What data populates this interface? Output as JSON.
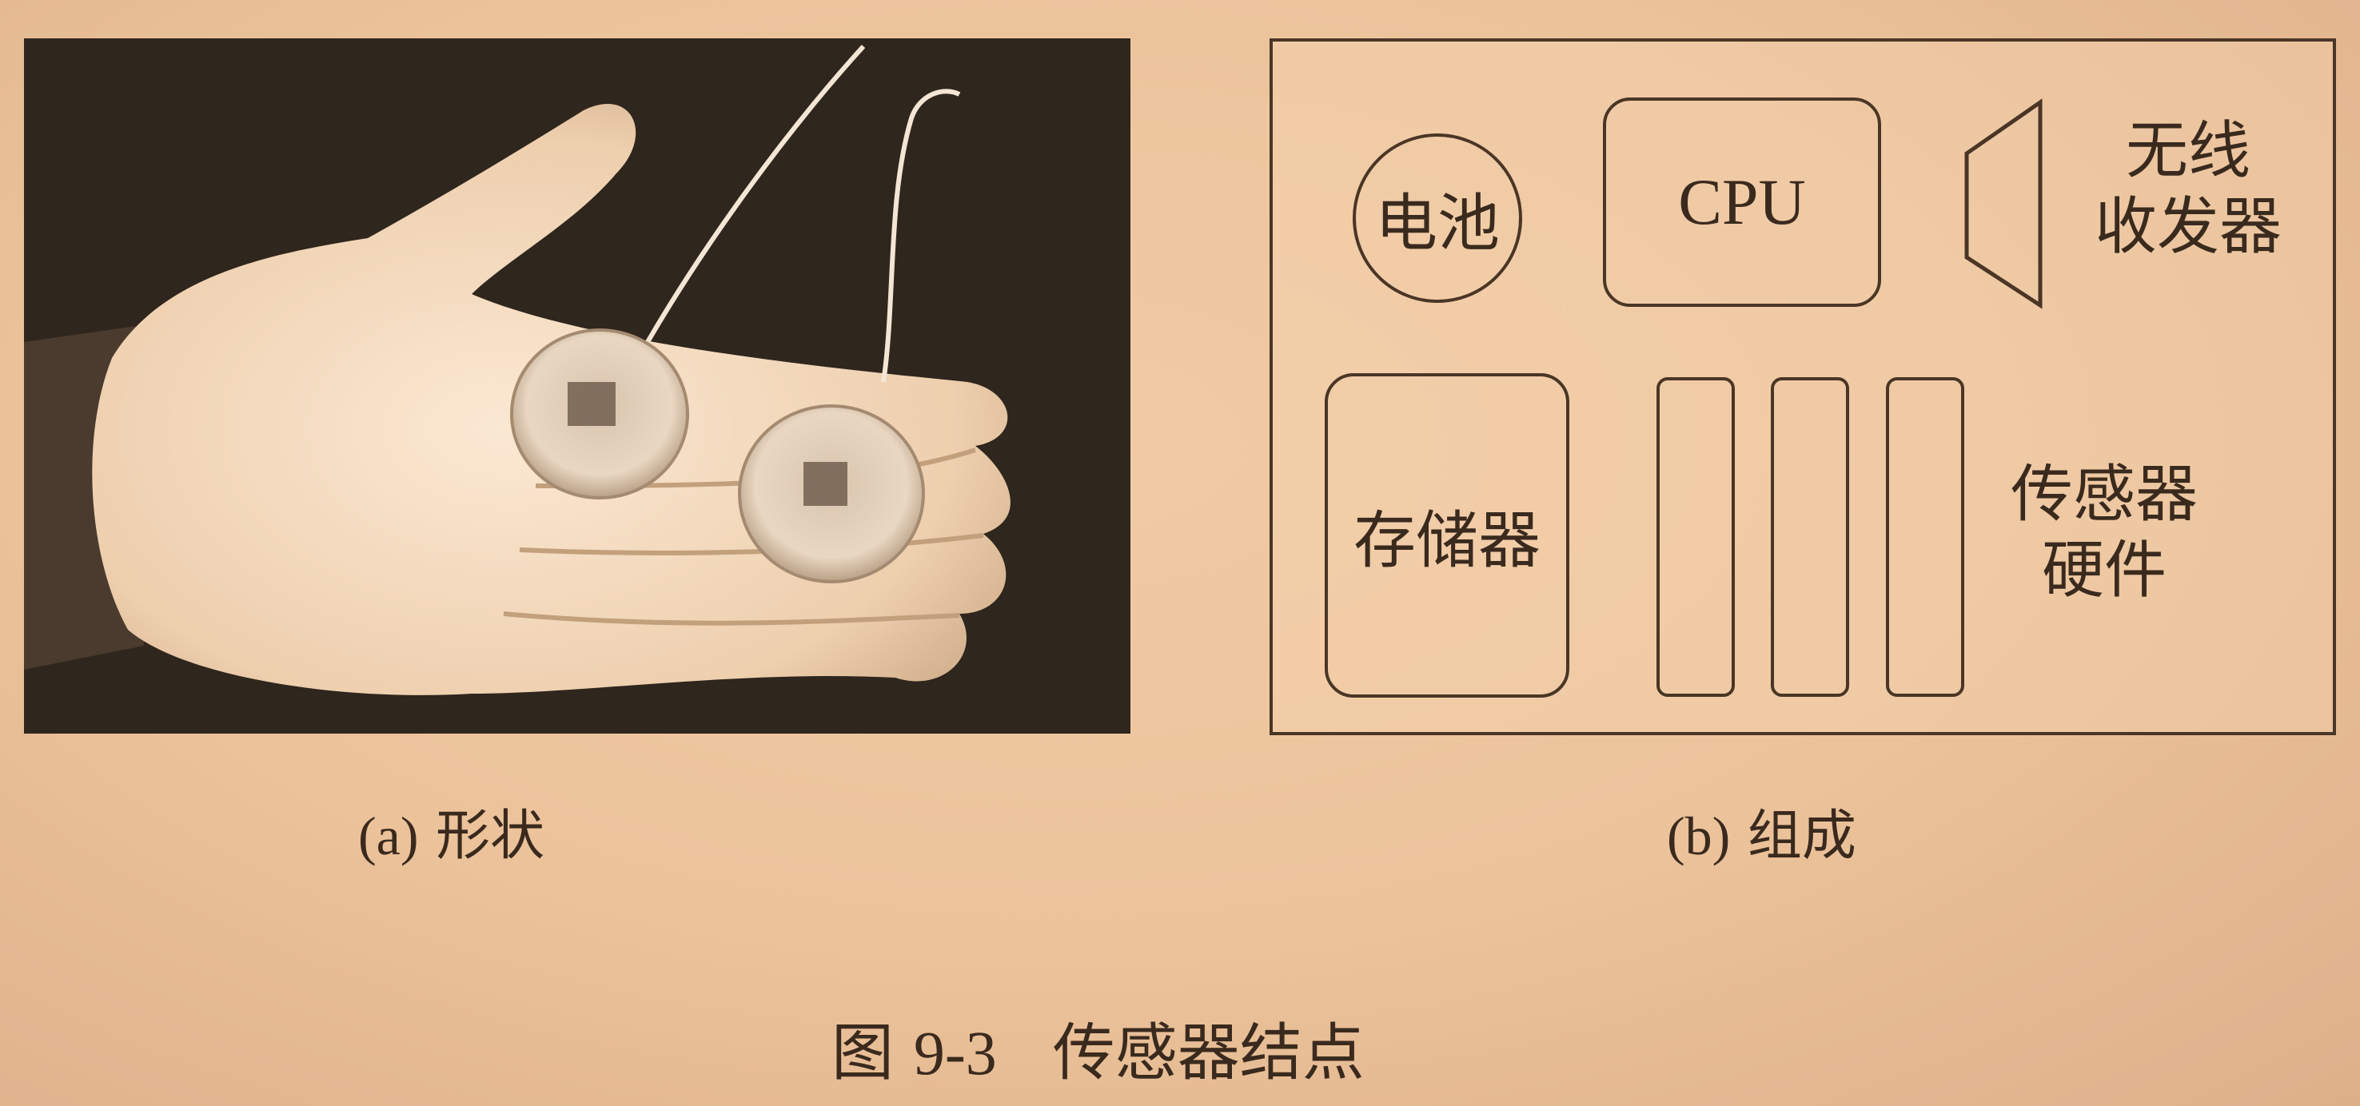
{
  "panel_a": {
    "caption_label": "(a)",
    "caption_text": "形状"
  },
  "panel_b": {
    "caption_label": "(b)",
    "caption_text": "组成",
    "battery": "电池",
    "cpu": "CPU",
    "radio_line1": "无线",
    "radio_line2": "收发器",
    "memory": "存储器",
    "sensor_hw_line1": "传感器",
    "sensor_hw_line2": "硬件"
  },
  "figure": {
    "prefix": "图",
    "number": "9-3",
    "title": "传感器结点"
  }
}
